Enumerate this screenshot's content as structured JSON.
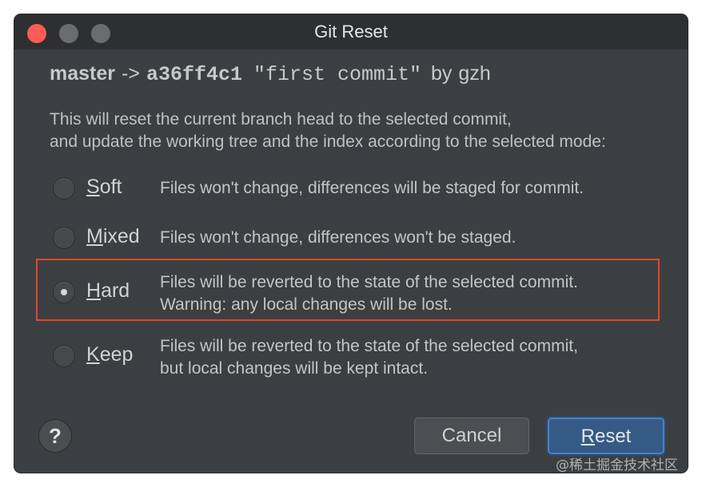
{
  "window": {
    "title": "Git Reset"
  },
  "header": {
    "branch": "master",
    "arrow": "->",
    "hash": "a36ff4c1",
    "message": "\"first commit\"",
    "by": "by",
    "author": "gzh"
  },
  "description": {
    "line1": "This will reset the current branch head to the selected commit,",
    "line2": "and update the working tree and the index according to the selected mode:"
  },
  "options": [
    {
      "mnemonic": "S",
      "label_rest": "oft",
      "line1": "Files won't change, differences will be staged for commit.",
      "line2": "",
      "selected": false
    },
    {
      "mnemonic": "M",
      "label_rest": "ixed",
      "line1": "Files won't change, differences won't be staged.",
      "line2": "",
      "selected": false
    },
    {
      "mnemonic": "H",
      "label_rest": "ard",
      "line1": "Files will be reverted to the state of the selected commit.",
      "line2": "Warning: any local changes will be lost.",
      "selected": true
    },
    {
      "mnemonic": "K",
      "label_rest": "eep",
      "line1": "Files will be reverted to the state of the selected commit,",
      "line2": "but local changes will be kept intact.",
      "selected": false
    }
  ],
  "buttons": {
    "help": "?",
    "cancel": "Cancel",
    "reset_mnemonic": "R",
    "reset_rest": "eset"
  },
  "watermark": "@稀土掘金技术社区",
  "colors": {
    "highlight_border": "#e2452e",
    "default_button": "#355a86",
    "close_button": "#fc5c56"
  }
}
